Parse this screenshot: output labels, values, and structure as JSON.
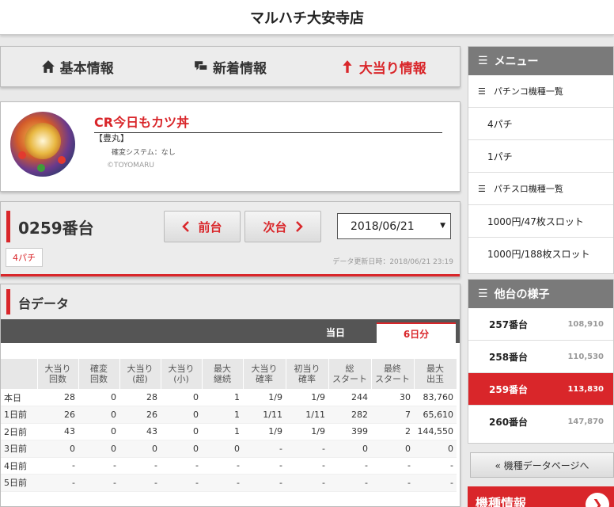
{
  "header": {
    "title": "マルハチ大安寺店"
  },
  "tabs": [
    {
      "label": "基本情報",
      "icon": "home-icon"
    },
    {
      "label": "新着情報",
      "icon": "chat-icon"
    },
    {
      "label": "大当り情報",
      "icon": "arrow-up-icon"
    }
  ],
  "machine": {
    "name": "CR今日もカツ丼",
    "maker": "【豊丸】",
    "system": "確変システム：なし",
    "copyright": "©TOYOMARU"
  },
  "unit": {
    "number": "0259番台",
    "prev_label": "前台",
    "next_label": "次台",
    "date": "2018/06/21",
    "type": "4パチ",
    "updated": "データ更新日時：2018/06/21 23:19"
  },
  "data": {
    "title": "台データ",
    "tab_today": "当日",
    "tab_six": "6日分",
    "columns": [
      "",
      "大当り\n回数",
      "確変\n回数",
      "大当り\n(超)",
      "大当り\n(小)",
      "最大\n継続",
      "大当り\n確率",
      "初当り\n確率",
      "総\nスタート",
      "最終\nスタート",
      "最大\n出玉"
    ],
    "rows": [
      [
        "本日",
        "28",
        "0",
        "28",
        "0",
        "1",
        "1/9",
        "1/9",
        "244",
        "30",
        "83,760"
      ],
      [
        "1日前",
        "26",
        "0",
        "26",
        "0",
        "1",
        "1/11",
        "1/11",
        "282",
        "7",
        "65,610"
      ],
      [
        "2日前",
        "43",
        "0",
        "43",
        "0",
        "1",
        "1/9",
        "1/9",
        "399",
        "2",
        "144,550"
      ],
      [
        "3日前",
        "0",
        "0",
        "0",
        "0",
        "0",
        "-",
        "-",
        "0",
        "0",
        "0"
      ],
      [
        "4日前",
        "-",
        "-",
        "-",
        "-",
        "-",
        "-",
        "-",
        "-",
        "-",
        "-"
      ],
      [
        "5日前",
        "-",
        "-",
        "-",
        "-",
        "-",
        "-",
        "-",
        "-",
        "-",
        "-"
      ]
    ]
  },
  "menu": {
    "title": "メニュー",
    "pachinko_list": "パチンコ機種一覧",
    "pachinko_items": [
      "4パチ",
      "1パチ"
    ],
    "slot_list": "パチスロ機種一覧",
    "slot_items": [
      "1000円/47枚スロット",
      "1000円/188枚スロット"
    ]
  },
  "others": {
    "title": "他台の様子",
    "units": [
      {
        "name": "257番台",
        "value": "108,910"
      },
      {
        "name": "258番台",
        "value": "110,530"
      },
      {
        "name": "259番台",
        "value": "113,830"
      },
      {
        "name": "260番台",
        "value": "147,870"
      }
    ]
  },
  "back_label": "« 機種データページへ",
  "promo_label": "機種情報",
  "colors": {
    "accent": "#d9262a",
    "sidebar_head": "#7a7a7a"
  }
}
